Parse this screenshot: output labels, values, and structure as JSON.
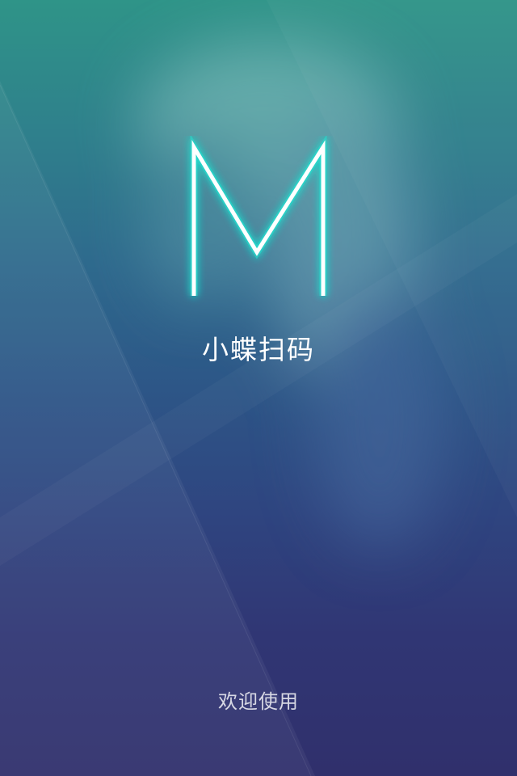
{
  "splash": {
    "logo_letter": "M",
    "app_name": "小蝶扫码",
    "welcome_text": "欢迎使用"
  },
  "colors": {
    "gradient_top": "#2f9488",
    "gradient_bottom": "#30306c",
    "logo_stroke": "#ffffff",
    "logo_glow": "#20e0d0",
    "text": "#ffffff"
  }
}
